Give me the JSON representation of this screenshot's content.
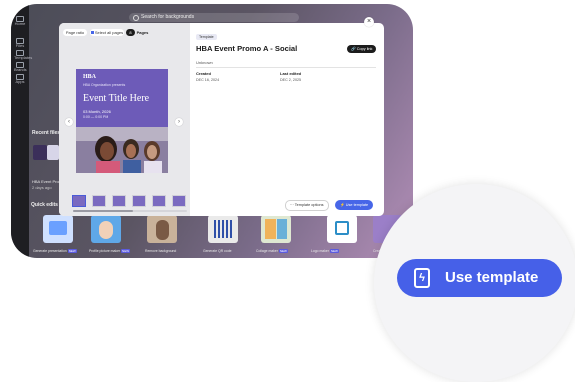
{
  "background": {
    "search_placeholder": "Search for backgrounds"
  },
  "left_nav": [
    "Home",
    "Files",
    "Templates",
    "Brands",
    "Apps"
  ],
  "recent": {
    "heading": "Recent files",
    "item_name": "HBA Event Promo A",
    "item_time": "2 days ago"
  },
  "quick_actions": {
    "heading": "Quick edits",
    "items": [
      {
        "label": "Generate presentation",
        "is_new": true
      },
      {
        "label": "Profile picture maker",
        "is_new": true
      },
      {
        "label": "Remove background",
        "is_new": false
      },
      {
        "label": "Generate QR code",
        "is_new": false
      },
      {
        "label": "Collage maker",
        "is_new": true
      },
      {
        "label": "Logo maker",
        "is_new": true
      },
      {
        "label": "Create",
        "is_new": false
      }
    ],
    "new_label": "NEW"
  },
  "modal": {
    "page_ratio_label": "Page ratio",
    "select_all_label": "Select all pages",
    "page_count": "8",
    "page_count_unit": "Pages",
    "preview": {
      "logo": "HBA",
      "subtitle": "HBA Organization presents",
      "event_title": "Event Title Here",
      "date": "03 Month, 2026",
      "time": "0:00 — 0:00 PM"
    },
    "badge": "Template",
    "title": "HBA Event Promo A - Social",
    "copy_link": "Copy link",
    "owner": "Unknown",
    "created_label": "Created",
    "created_value": "DEC 16, 2024",
    "edited_label": "Last edited",
    "edited_value": "DEC 2, 2025",
    "template_options": "Template options",
    "use_template_small": "Use template",
    "close": "×"
  },
  "zoom": {
    "use_template": "Use template"
  },
  "colors": {
    "accent": "#4660e8",
    "poster_purple": "#6d5bb8"
  }
}
